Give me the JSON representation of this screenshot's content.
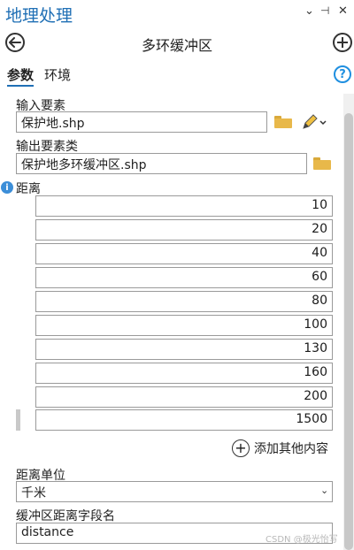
{
  "window": {
    "title": "地理处理",
    "ctrl_menu": "⌄",
    "ctrl_pin": "⊣",
    "ctrl_close": "✕"
  },
  "tool": {
    "title": "多环缓冲区"
  },
  "tabs": [
    {
      "label": "参数",
      "active": true
    },
    {
      "label": "环境",
      "active": false
    }
  ],
  "params": {
    "input_label": "输入要素",
    "input_value": "保护地.shp",
    "output_label": "输出要素类",
    "output_value": "保护地多环缓冲区.shp",
    "distance_label": "距离",
    "distances": [
      "10",
      "20",
      "40",
      "60",
      "80",
      "100",
      "130",
      "160",
      "200",
      "1500"
    ],
    "add_more_label": "添加其他内容",
    "unit_label": "距离单位",
    "unit_value": "千米",
    "field_label": "缓冲区距离字段名",
    "field_value": "distance"
  },
  "watermark": "CSDN @极光怡写",
  "colors": {
    "accent": "#1f6fb5",
    "folder": "#e8b84a",
    "info": "#3c8ed8"
  }
}
